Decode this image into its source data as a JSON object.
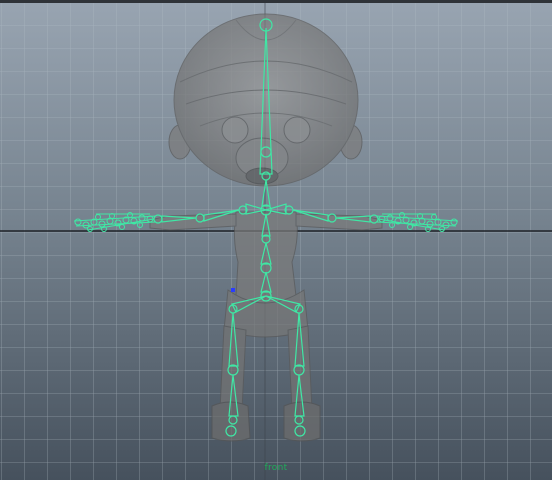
{
  "viewport": {
    "camera_label": "front",
    "grid": true,
    "background_top": "#8e9aa7",
    "background_bottom": "#4a5561",
    "grid_color": "#a8b3bf",
    "axis_color": "#1e2227",
    "skeleton_color": "#3fe8a5",
    "mesh_color": "#7a7a7a"
  }
}
